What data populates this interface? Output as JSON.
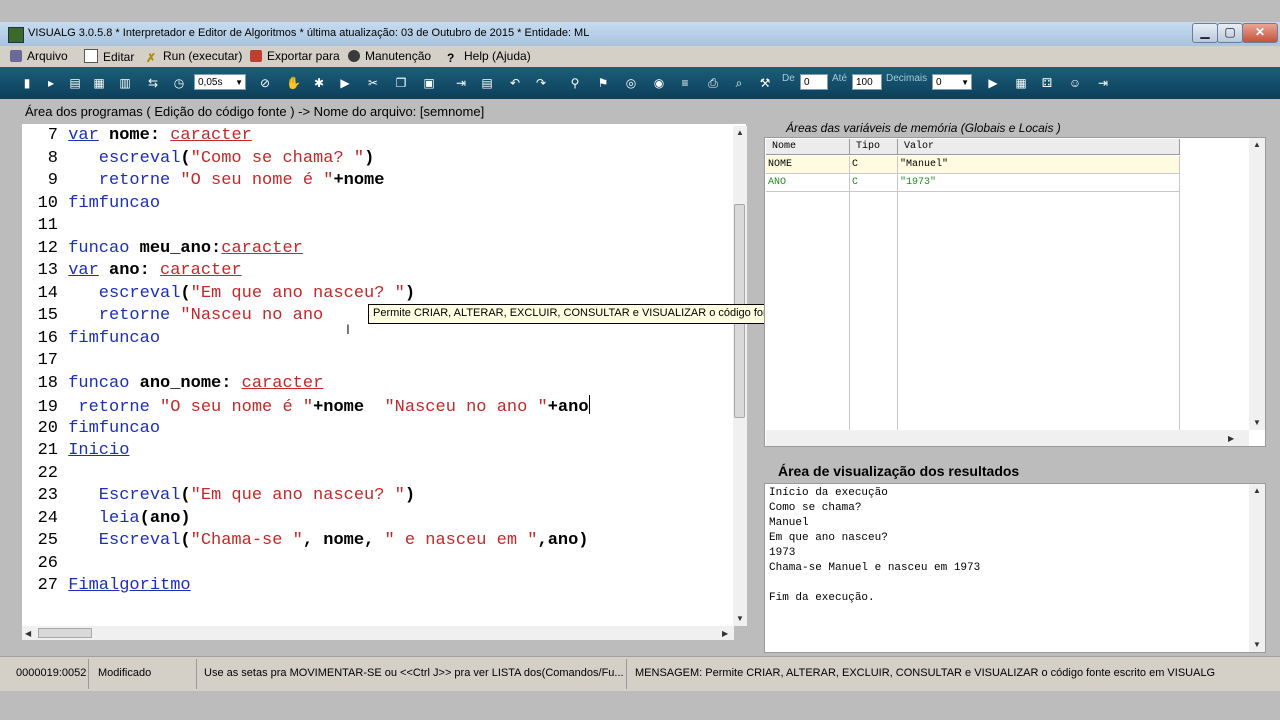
{
  "window": {
    "title": "VISUALG 3.0.5.8 * Interpretador e Editor de Algoritmos * última atualização: 03 de Outubro de 2015 * Entidade: ML"
  },
  "menu": [
    {
      "label": "Arquivo",
      "icon": "folder-icon"
    },
    {
      "label": "Editar",
      "icon": "edit-icon"
    },
    {
      "label": "Run (executar)",
      "icon": "run-icon"
    },
    {
      "label": "Exportar para",
      "icon": "export-icon"
    },
    {
      "label": "Manutenção",
      "icon": "maintenance-icon"
    },
    {
      "label": "Help (Ajuda)",
      "icon": "help-icon"
    }
  ],
  "toolbar": {
    "interval_value": "0,05s",
    "from_label": "De",
    "from_value": "0",
    "to_label": "Até",
    "to_value": "100",
    "decimals_label": "Decimais",
    "decimals_value": "0"
  },
  "editor": {
    "header": "Área dos programas ( Edição do código fonte ) -> Nome do arquivo: [semnome]",
    "lines": [
      {
        "num": "7",
        "tokens": [
          {
            "t": "var",
            "c": "kw ul"
          },
          {
            "t": " ",
            "c": ""
          },
          {
            "t": "nome:",
            "c": "var"
          },
          {
            "t": " ",
            "c": ""
          },
          {
            "t": "caracter",
            "c": "ty ul"
          }
        ]
      },
      {
        "num": "8",
        "tokens": [
          {
            "t": "   escreval",
            "c": "kw"
          },
          {
            "t": "(",
            "c": "var"
          },
          {
            "t": "\"Como se chama? \"",
            "c": "str"
          },
          {
            "t": ")",
            "c": "var"
          }
        ]
      },
      {
        "num": "9",
        "tokens": [
          {
            "t": "   retorne ",
            "c": "kw"
          },
          {
            "t": "\"O seu nome é \"",
            "c": "str"
          },
          {
            "t": "+nome",
            "c": "var"
          }
        ]
      },
      {
        "num": "10",
        "tokens": [
          {
            "t": "fimfuncao",
            "c": "kw"
          }
        ]
      },
      {
        "num": "11",
        "tokens": []
      },
      {
        "num": "12",
        "tokens": [
          {
            "t": "funcao ",
            "c": "kw"
          },
          {
            "t": "meu_ano:",
            "c": "var"
          },
          {
            "t": "caracter",
            "c": "ty ul"
          }
        ]
      },
      {
        "num": "13",
        "tokens": [
          {
            "t": "var",
            "c": "kw ul"
          },
          {
            "t": " ",
            "c": ""
          },
          {
            "t": "ano:",
            "c": "var"
          },
          {
            "t": " ",
            "c": ""
          },
          {
            "t": "caracter",
            "c": "ty ul"
          }
        ]
      },
      {
        "num": "14",
        "tokens": [
          {
            "t": "   escreval",
            "c": "kw"
          },
          {
            "t": "(",
            "c": "var"
          },
          {
            "t": "\"Em que ano nasceu? \"",
            "c": "str"
          },
          {
            "t": ")",
            "c": "var"
          }
        ]
      },
      {
        "num": "15",
        "tokens": [
          {
            "t": "   retorne ",
            "c": "kw"
          },
          {
            "t": "\"Nasceu no ano",
            "c": "str"
          }
        ]
      },
      {
        "num": "16",
        "tokens": [
          {
            "t": "fimfuncao",
            "c": "kw"
          }
        ]
      },
      {
        "num": "17",
        "tokens": []
      },
      {
        "num": "18",
        "tokens": [
          {
            "t": "funcao ",
            "c": "kw"
          },
          {
            "t": "ano_nome:",
            "c": "var"
          },
          {
            "t": " ",
            "c": ""
          },
          {
            "t": "caracter",
            "c": "ty ul"
          }
        ]
      },
      {
        "num": "19",
        "tokens": [
          {
            "t": " retorne ",
            "c": "kw"
          },
          {
            "t": "\"O seu nome é \"",
            "c": "str"
          },
          {
            "t": "+nome  ",
            "c": "var"
          },
          {
            "t": "\"Nasceu no ano \"",
            "c": "str"
          },
          {
            "t": "+ano",
            "c": "var"
          }
        ],
        "caret": true
      },
      {
        "num": "20",
        "tokens": [
          {
            "t": "fimfuncao",
            "c": "kw"
          }
        ]
      },
      {
        "num": "21",
        "tokens": [
          {
            "t": "Inicio",
            "c": "kw ul"
          }
        ]
      },
      {
        "num": "22",
        "tokens": []
      },
      {
        "num": "23",
        "tokens": [
          {
            "t": "   Escreval",
            "c": "kw"
          },
          {
            "t": "(",
            "c": "var"
          },
          {
            "t": "\"Em que ano nasceu? \"",
            "c": "str"
          },
          {
            "t": ")",
            "c": "var"
          }
        ]
      },
      {
        "num": "24",
        "tokens": [
          {
            "t": "   leia",
            "c": "kw"
          },
          {
            "t": "(ano)",
            "c": "var"
          }
        ]
      },
      {
        "num": "25",
        "tokens": [
          {
            "t": "   Escreval",
            "c": "kw"
          },
          {
            "t": "(",
            "c": "var"
          },
          {
            "t": "\"Chama-se \"",
            "c": "str"
          },
          {
            "t": ", nome, ",
            "c": "var"
          },
          {
            "t": "\" e nasceu em \"",
            "c": "str"
          },
          {
            "t": ",ano)",
            "c": "var"
          }
        ]
      },
      {
        "num": "26",
        "tokens": []
      },
      {
        "num": "27",
        "tokens": [
          {
            "t": "Fimalgoritmo",
            "c": "kw ul"
          }
        ]
      }
    ]
  },
  "tooltip": "Permite CRIAR, ALTERAR, EXCLUIR, CONSULTAR e VISUALIZAR o código fonte escrito em VISUALG",
  "variables": {
    "title": "Áreas das variáveis de memória (Globais e Locais )",
    "columns": [
      "Nome",
      "Tipo",
      "Valor"
    ],
    "rows": [
      {
        "name": "NOME",
        "type": "C",
        "value": "\"Manuel\"",
        "color": "#000000",
        "bg": "#fffbe0"
      },
      {
        "name": "ANO",
        "type": "C",
        "value": "\"1973\"",
        "color": "#1f8a1f",
        "bg": "#ffffff"
      }
    ]
  },
  "results": {
    "title": "Área de visualização dos resultados",
    "lines": [
      "Início da execução",
      "Como se chama?",
      "Manuel",
      "Em que ano nasceu?",
      "1973",
      "Chama-se Manuel e nasceu em 1973",
      "",
      "Fim da execução."
    ]
  },
  "status": {
    "position": "0000019:0052",
    "state": "Modificado",
    "hint": "Use as setas pra MOVIMENTAR-SE ou <<Ctrl J>> pra ver LISTA dos(Comandos/Fu...",
    "message": "MENSAGEM: Permite CRIAR, ALTERAR, EXCLUIR, CONSULTAR e VISUALIZAR o código fonte escrito em VISUALG"
  }
}
